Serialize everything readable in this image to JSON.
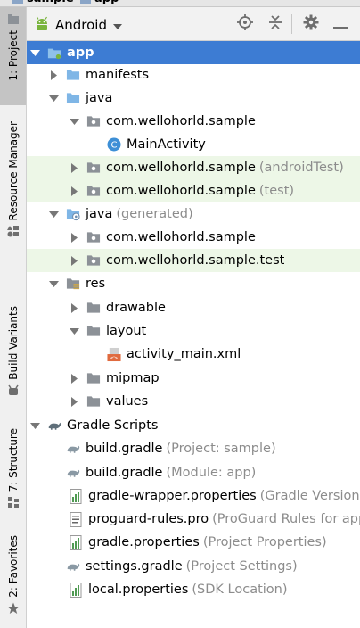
{
  "breadcrumb": {
    "root": "sample",
    "child": "app"
  },
  "side_tabs": {
    "project": "1: Project",
    "resource_manager": "Resource Manager",
    "build_variants": "Build Variants",
    "structure": "7: Structure",
    "favorites": "2: Favorites"
  },
  "header": {
    "view": "Android"
  },
  "tree": {
    "app": "app",
    "manifests": "manifests",
    "java": "java",
    "pkg_main": "com.wellohorld.sample",
    "main_activity": "MainActivity",
    "pkg_android_test": "com.wellohorld.sample",
    "pkg_android_test_hint": "(androidTest)",
    "pkg_test": "com.wellohorld.sample",
    "pkg_test_hint": "(test)",
    "java_generated": "java",
    "java_generated_hint": "(generated)",
    "gen_pkg1": "com.wellohorld.sample",
    "gen_pkg2": "com.wellohorld.sample.test",
    "res": "res",
    "drawable": "drawable",
    "layout": "layout",
    "activity_main": "activity_main.xml",
    "mipmap": "mipmap",
    "values": "values",
    "gradle_scripts": "Gradle Scripts",
    "build_gradle_project": "build.gradle",
    "build_gradle_project_hint": "(Project: sample)",
    "build_gradle_module": "build.gradle",
    "build_gradle_module_hint": "(Module: app)",
    "gradle_wrapper": "gradle-wrapper.properties",
    "gradle_wrapper_hint": "(Gradle Version)",
    "proguard": "proguard-rules.pro",
    "proguard_hint": "(ProGuard Rules for app",
    "gradle_properties": "gradle.properties",
    "gradle_properties_hint": "(Project Properties)",
    "settings_gradle": "settings.gradle",
    "settings_gradle_hint": "(Project Settings)",
    "local_properties": "local.properties",
    "local_properties_hint": "(SDK Location)"
  },
  "colors": {
    "selection": "#3d7cd3",
    "test_row_bg": "#edf7e7",
    "hint_text": "#8c8c8c",
    "folder_blue": "#7fb6e6",
    "folder_gray": "#8c9197",
    "android_green": "#79b43d"
  },
  "icons": {
    "header": [
      "locate-icon",
      "collapse-all-icon",
      "gear-icon",
      "minimize-icon"
    ],
    "tree": [
      "folder-icon",
      "package-icon",
      "class-icon",
      "layout-file-icon",
      "gradle-icon",
      "properties-file-icon",
      "text-file-icon"
    ]
  }
}
